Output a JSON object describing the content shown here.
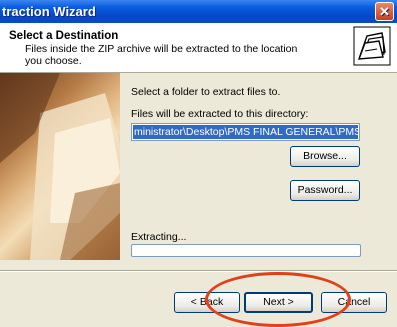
{
  "window": {
    "title": "traction Wizard",
    "close_glyph": "✕"
  },
  "header": {
    "title": "Select a Destination",
    "description": "Files inside the ZIP archive will be extracted to the location you choose.",
    "icon": "folders-wizard-icon"
  },
  "main": {
    "instruction": "Select a folder to extract files to.",
    "dir_label": "Files will be extracted to this directory:",
    "path_value": "ministrator\\Desktop\\PMS FINAL GENERAL\\PMS",
    "browse_label": "Browse...",
    "password_label": "Password...",
    "extracting_label": "Extracting...",
    "progress": 0
  },
  "footer": {
    "back_label": "< Back",
    "next_label": "Next >",
    "cancel_label": "Cancel"
  },
  "colors": {
    "title_bar": "#0a5ee0",
    "selection": "#316ac5",
    "annotation": "#e0401a",
    "face": "#ece9d8"
  }
}
